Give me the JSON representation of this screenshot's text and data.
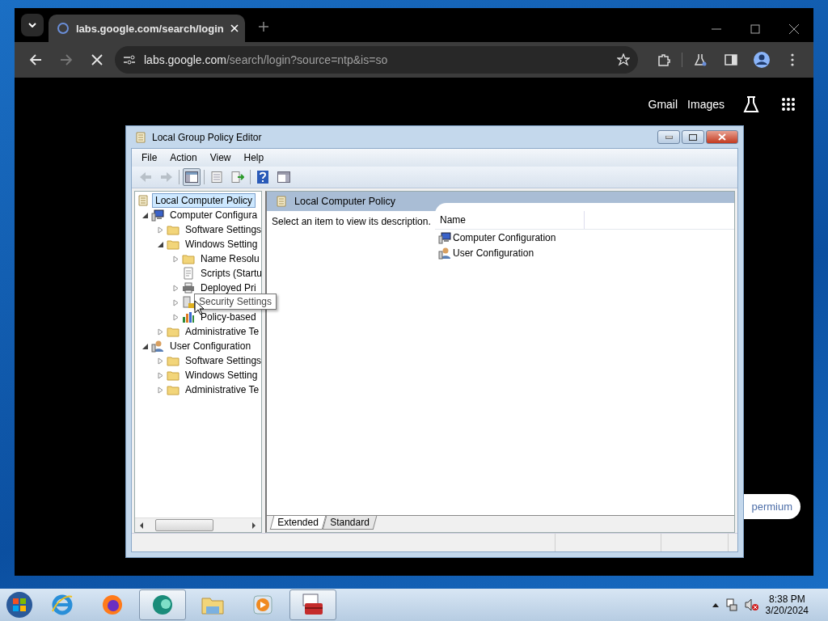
{
  "browser": {
    "tab_title": "labs.google.com/search/login",
    "address_host": "labs.google.com",
    "address_path": "/search/login?source=ntp&is=so",
    "forward_disabled": true
  },
  "page": {
    "links": [
      "Gmail",
      "Images"
    ],
    "pill": "permium"
  },
  "gpe": {
    "title": "Local Group Policy Editor",
    "menu": [
      "File",
      "Action",
      "View",
      "Help"
    ],
    "tree": [
      {
        "label": "Local Computer Policy",
        "kind": "policy",
        "selected": true,
        "children": [
          {
            "label": "Computer Configura",
            "kind": "computer",
            "expanded": true,
            "selected": false,
            "children": [
              {
                "label": "Software Settings",
                "kind": "folder",
                "expanded": false,
                "selected": false
              },
              {
                "label": "Windows Setting",
                "kind": "folder",
                "expanded": true,
                "selected": false,
                "children": [
                  {
                    "label": "Name Resolu",
                    "kind": "folder",
                    "expanded": false,
                    "selected": false
                  },
                  {
                    "label": "Scripts (Startu",
                    "kind": "script",
                    "selected": false
                  },
                  {
                    "label": "Deployed Pri",
                    "kind": "printer",
                    "expanded": false,
                    "selected": false
                  },
                  {
                    "kind": "security",
                    "expanded": false
                  },
                  {
                    "label": "Policy-based",
                    "kind": "chart",
                    "expanded": false,
                    "selected": false
                  }
                ]
              },
              {
                "label": "Administrative Te",
                "kind": "folder",
                "expanded": false,
                "selected": false
              }
            ]
          },
          {
            "label": "User Configuration",
            "kind": "user",
            "expanded": true,
            "selected": false,
            "children": [
              {
                "label": "Software Settings",
                "kind": "folder",
                "expanded": false,
                "selected": false
              },
              {
                "label": "Windows Setting",
                "kind": "folder",
                "expanded": false,
                "selected": false
              },
              {
                "label": "Administrative Te",
                "kind": "folder",
                "expanded": false,
                "selected": false
              }
            ]
          }
        ]
      }
    ],
    "tooltip": "Security Settings",
    "pane_title": "Local Computer Policy",
    "description": "Select an item to view its description.",
    "columns": [
      "Name"
    ],
    "rows": [
      {
        "name": "Computer Configuration",
        "kind": "computer"
      },
      {
        "name": "User Configuration",
        "kind": "user"
      }
    ],
    "tabs": [
      {
        "label": "Extended",
        "selected": true
      },
      {
        "label": "Standard",
        "selected": false
      }
    ]
  },
  "taskbar": {
    "apps": [
      {
        "kind": "ie",
        "selected": false
      },
      {
        "kind": "firefox",
        "selected": false
      },
      {
        "kind": "bubble",
        "selected": true
      },
      {
        "kind": "explorer",
        "selected": false
      },
      {
        "kind": "media",
        "selected": false
      },
      {
        "kind": "toolbox",
        "selected": true
      }
    ],
    "time": "8:38 PM",
    "date": "3/20/2024"
  }
}
